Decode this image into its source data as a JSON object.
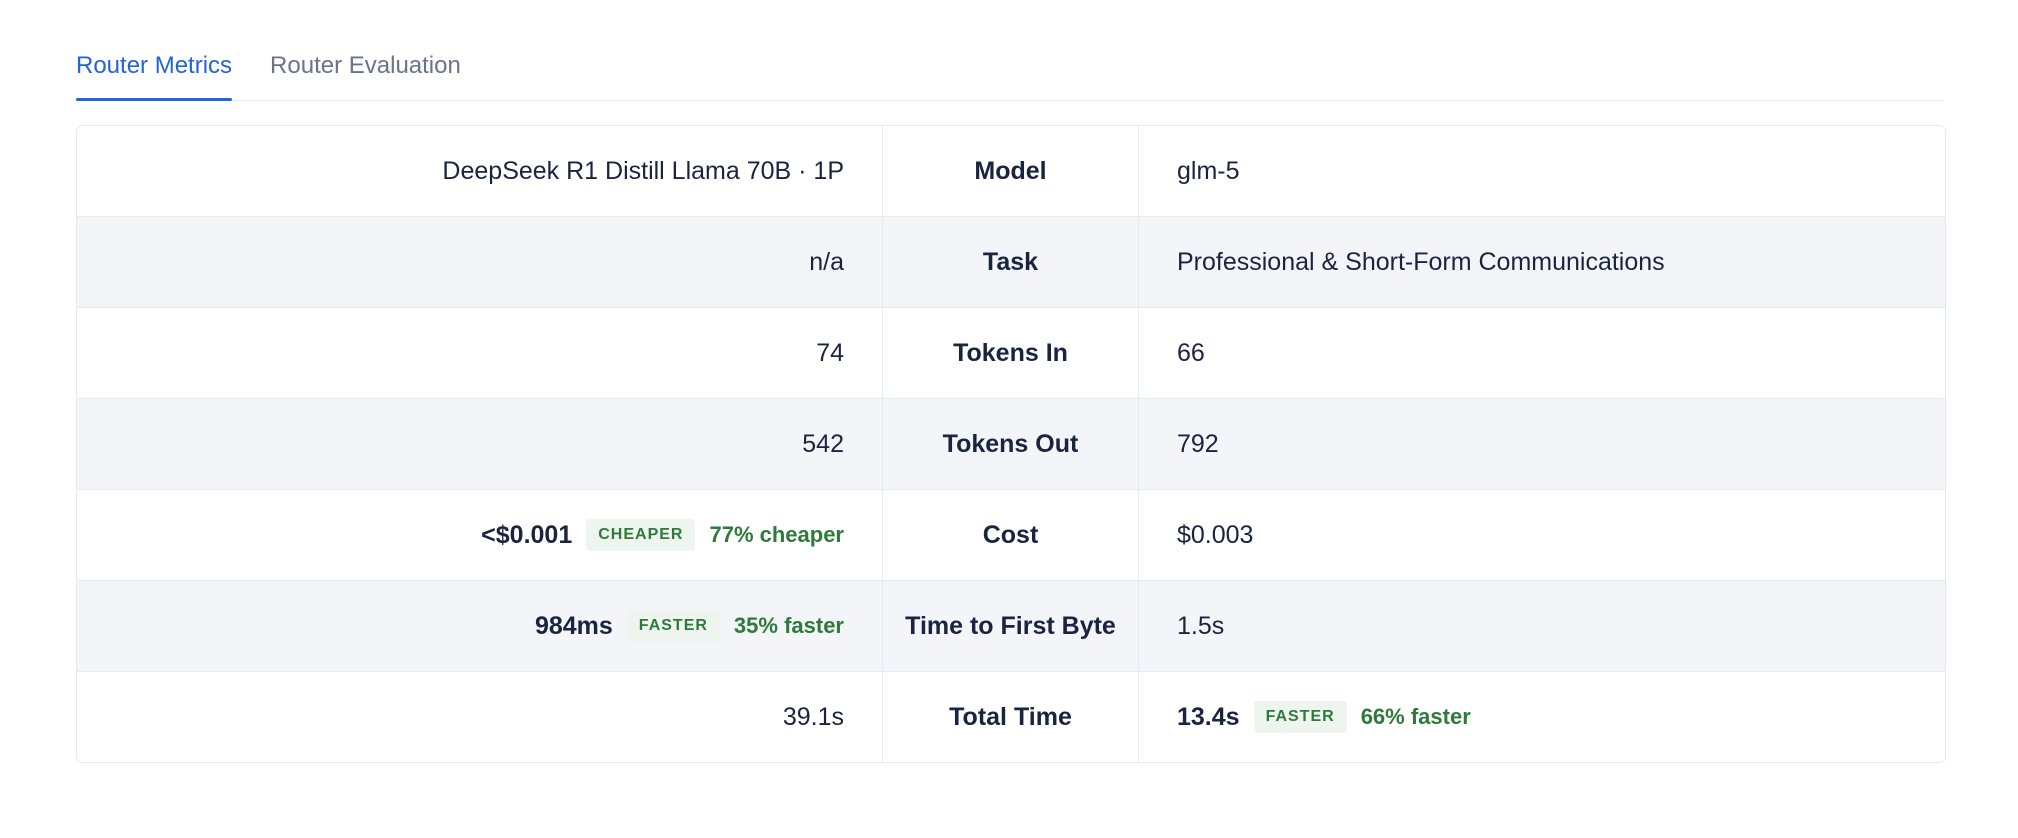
{
  "tabs": [
    {
      "label": "Router Metrics",
      "active": true
    },
    {
      "label": "Router Evaluation",
      "active": false
    }
  ],
  "colors": {
    "accent": "#2563d9",
    "positive": "#2f7a3b",
    "badge_bg": "#eef5ee",
    "row_alt_bg": "#f3f5f8"
  },
  "rows": [
    {
      "label": "Model",
      "left": "DeepSeek R1 Distill Llama 70B · 1P",
      "right": "glm-5"
    },
    {
      "label": "Task",
      "left": "n/a",
      "right": "Professional & Short-Form Communications"
    },
    {
      "label": "Tokens In",
      "left": "74",
      "right": "66"
    },
    {
      "label": "Tokens Out",
      "left": "542",
      "right": "792"
    },
    {
      "label": "Cost",
      "left": "<$0.001",
      "left_badge": "CHEAPER",
      "left_delta": "77% cheaper",
      "right": "$0.003"
    },
    {
      "label": "Time to First Byte",
      "left": "984ms",
      "left_badge": "FASTER",
      "left_delta": "35% faster",
      "right": "1.5s"
    },
    {
      "label": "Total Time",
      "left": "39.1s",
      "right": "13.4s",
      "right_badge": "FASTER",
      "right_delta": "66% faster"
    }
  ]
}
